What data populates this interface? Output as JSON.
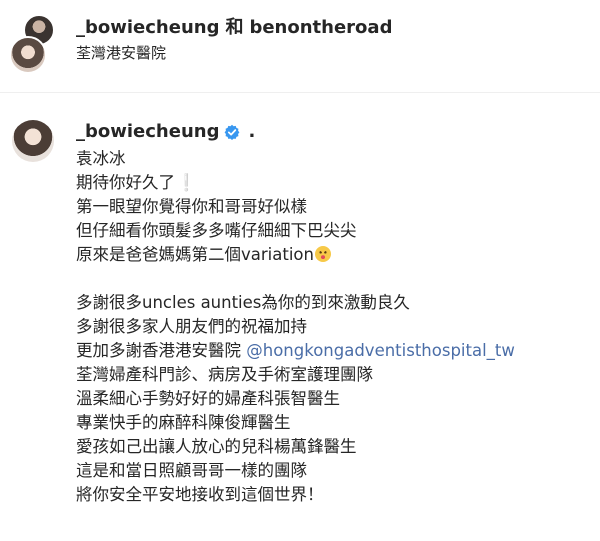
{
  "header": {
    "user1": "_bowiecheung",
    "joiner": "和",
    "user2": "benontheroad",
    "location": "荃灣港安醫院"
  },
  "post": {
    "author": "_bowiecheung",
    "dot": ".",
    "lines": {
      "l1": "袁冰冰",
      "l2": "期待你好久了",
      "l3": "第一眼望你覺得你和哥哥好似樣",
      "l4": "但仔細看你頭髮多多嘴仔細細下巴尖尖",
      "l5": "原來是爸爸媽媽第二個variation",
      "l6": "多謝很多uncles aunties為你的到來激動良久",
      "l7": "多謝很多家人朋友們的祝福加持",
      "l8_prefix": "更加多謝香港港安醫院 ",
      "l8_mention": "@hongkongadventisthospital_tw",
      "l9": "荃灣婦產科門診、病房及手術室護理團隊",
      "l10": "溫柔細心手勢好好的婦產科張智醫生",
      "l11": "專業快手的麻醉科陳俊輝醫生",
      "l12": "愛孩如己出讓人放心的兒科楊萬鋒醫生",
      "l13": "這是和當日照顧哥哥一樣的團隊",
      "l14": "將你安全平安地接收到這個世界！"
    },
    "emojis": {
      "exclamation": "❕",
      "kiss": "kissing-face-icon"
    }
  },
  "colors": {
    "text": "#262626",
    "mention": "#4a6da7",
    "verified": "#3897f0",
    "divider": "#efefef"
  }
}
